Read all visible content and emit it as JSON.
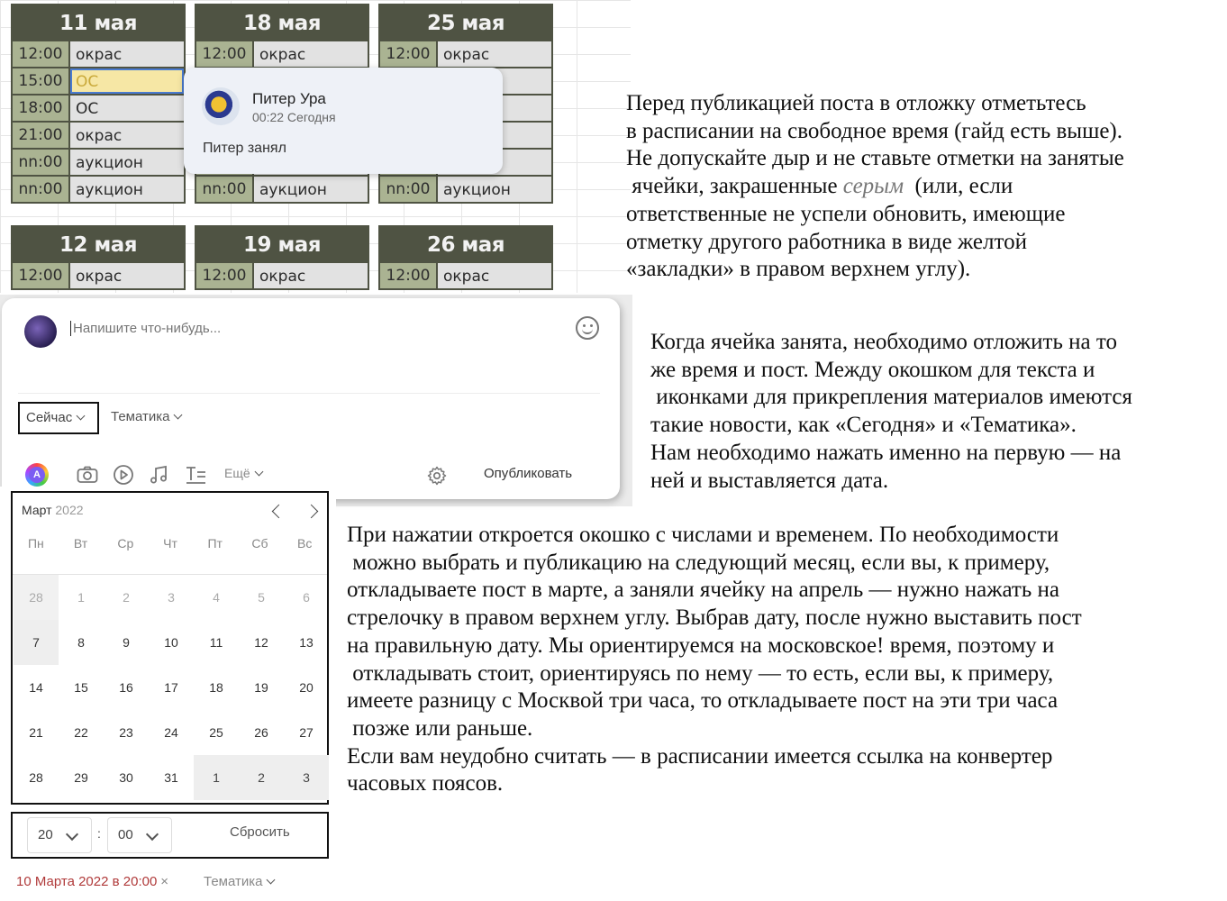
{
  "schedule": {
    "days": [
      {
        "title": "11 мая",
        "slots": [
          {
            "time": "12:00",
            "task": "окрас"
          },
          {
            "time": "15:00",
            "task": "ОС",
            "highlighted": true
          },
          {
            "time": "18:00",
            "task": "ОС"
          },
          {
            "time": "21:00",
            "task": "окрас"
          },
          {
            "time": "nn:00",
            "task": "аукцион"
          },
          {
            "time": "nn:00",
            "task": "аукцион"
          }
        ]
      },
      {
        "title": "18 мая",
        "slots": [
          {
            "time": "12:00",
            "task": "окрас"
          },
          {
            "time": "",
            "task": ""
          },
          {
            "time": "",
            "task": ""
          },
          {
            "time": "",
            "task": ""
          },
          {
            "time": "",
            "task": ""
          },
          {
            "time": "nn:00",
            "task": "аукцион"
          }
        ]
      },
      {
        "title": "25 мая",
        "slots": [
          {
            "time": "12:00",
            "task": "окрас"
          },
          {
            "time": "",
            "task": ""
          },
          {
            "time": "",
            "task": ""
          },
          {
            "time": "",
            "task": ""
          },
          {
            "time": "",
            "task": ""
          },
          {
            "time": "nn:00",
            "task": "аукцион"
          }
        ]
      },
      {
        "title": "12 мая",
        "slots": [
          {
            "time": "12:00",
            "task": "окрас"
          }
        ]
      },
      {
        "title": "19 мая",
        "slots": [
          {
            "time": "12:00",
            "task": "окрас"
          }
        ]
      },
      {
        "title": "26 мая",
        "slots": [
          {
            "time": "12:00",
            "task": "окрас"
          }
        ]
      }
    ],
    "comment": {
      "author": "Питер Ура",
      "time": "00:22 Сегодня",
      "text": "Питер занял"
    }
  },
  "composer": {
    "placeholder": "Напишите что-нибудь...",
    "when_button": "Сейчас",
    "topic_button": "Тематика",
    "toolbar": {
      "color_icon_letter": "A",
      "icons": [
        "color-palette-icon",
        "camera-icon",
        "video-play-icon",
        "music-note-icon",
        "text-format-icon"
      ],
      "more_label": "Ещё",
      "publish_label": "Опубликовать"
    }
  },
  "calendar": {
    "month": "Март",
    "year": "2022",
    "weekdays": [
      "Пн",
      "Вт",
      "Ср",
      "Чт",
      "Пт",
      "Сб",
      "Вс"
    ],
    "weeks": [
      [
        "28",
        "1",
        "2",
        "3",
        "4",
        "5",
        "6"
      ],
      [
        "7",
        "8",
        "9",
        "10",
        "11",
        "12",
        "13"
      ],
      [
        "14",
        "15",
        "16",
        "17",
        "18",
        "19",
        "20"
      ],
      [
        "21",
        "22",
        "23",
        "24",
        "25",
        "26",
        "27"
      ],
      [
        "28",
        "29",
        "30",
        "31",
        "1",
        "2",
        "3"
      ]
    ],
    "hour": "20",
    "minute": "00",
    "reset_label": "Сбросить",
    "selected_date_label": "10 Марта 2022 в 20:00",
    "topic_label": "Тематика"
  },
  "instructions": {
    "p1_lines": [
      "Перед публикацией поста в отложку отметьтесь",
      "в расписании на свободное время (гайд есть выше).",
      "Не допускайте дыр и не ставьте отметки на занятые",
      " ячейки, закрашенные ",
      "серым",
      "  (или, если",
      "ответственные не успели обновить, имеющие",
      "отметку другого работника в виде желтой",
      "«закладки» в правом верхнем углу)."
    ],
    "p2_lines": [
      "Когда ячейка занята, необходимо отложить на то",
      "же время и пост. Между окошком для текста и",
      " иконками для прикрепления материалов имеются",
      "такие новости, как «Сегодня» и «Тематика».",
      "Нам необходимо нажать именно на первую — на",
      "ней и выставляется дата."
    ],
    "p3_lines": [
      "При нажатии откроется окошко с числами и временем. По необходимости",
      " можно выбрать и публикацию на следующий месяц, если вы, к примеру,",
      "откладываете пост в марте, а заняли ячейку на апрель — нужно нажать на",
      "стрелочку в правом верхнем углу. Выбрав дату, после нужно выставить пост",
      "на правильную дату. Мы ориентируемся на московское! время, поэтому и",
      " откладывать стоит, ориентируясь по нему — то есть, если вы, к примеру,",
      "имеете разницу с Москвой три часа, то откладываете пост на эти три часа",
      " позже или раньше.",
      "Если вам неудобно считать — в расписании имеется ссылка на конвертер",
      "часовых поясов."
    ]
  }
}
